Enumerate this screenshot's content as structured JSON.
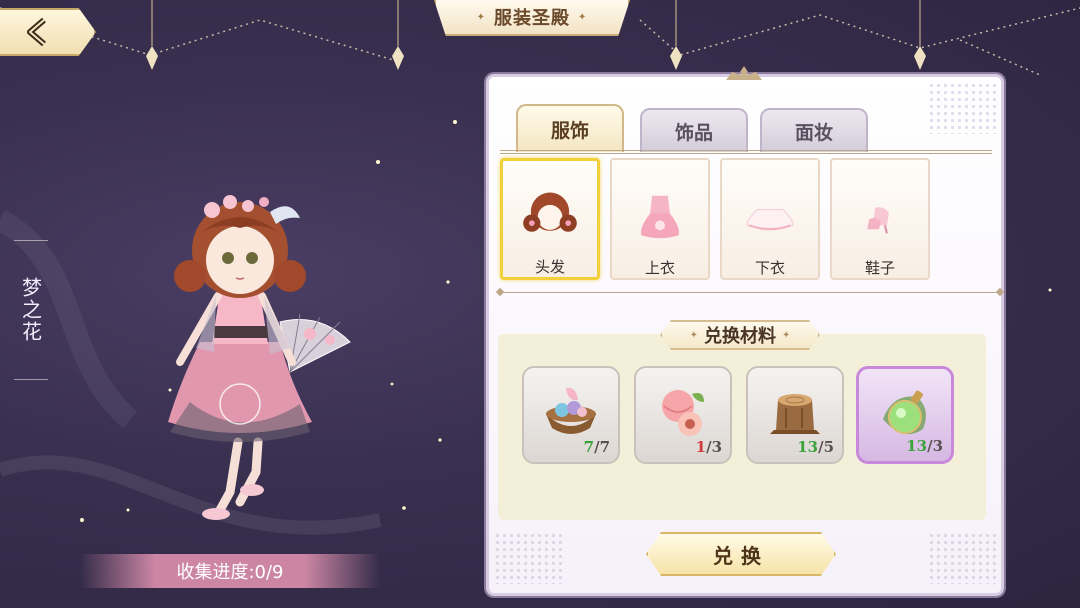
{
  "header": {
    "title": "服装圣殿",
    "back_icon": "chevron-left-icon"
  },
  "character": {
    "name": "梦之花",
    "progress_text": "收集进度:0/9"
  },
  "tabs": [
    {
      "label": "服饰",
      "active": true
    },
    {
      "label": "饰品",
      "active": false
    },
    {
      "label": "面妆",
      "active": false
    }
  ],
  "categories": [
    {
      "label": "头发",
      "icon": "hair-icon",
      "selected": true
    },
    {
      "label": "上衣",
      "icon": "top-dress-icon",
      "selected": false
    },
    {
      "label": "下衣",
      "icon": "skirt-icon",
      "selected": false
    },
    {
      "label": "鞋子",
      "icon": "shoes-icon",
      "selected": false
    }
  ],
  "materials": {
    "header": "兑换材料",
    "items": [
      {
        "icon": "flower-basket-icon",
        "have": "7",
        "need": "7",
        "enough": true
      },
      {
        "icon": "peach-icon",
        "have": "1",
        "need": "3",
        "enough": false
      },
      {
        "icon": "tree-stump-icon",
        "have": "13",
        "need": "5",
        "enough": true
      },
      {
        "icon": "green-potion-icon",
        "have": "13",
        "need": "3",
        "enough": true
      }
    ]
  },
  "exchange_button": "兑换",
  "colors": {
    "background": "#3a3050",
    "accent_gold": "#f1d03a",
    "ok_green": "#3aa33a",
    "short_red": "#d23a3a",
    "rare_purple": "#c888dc"
  }
}
